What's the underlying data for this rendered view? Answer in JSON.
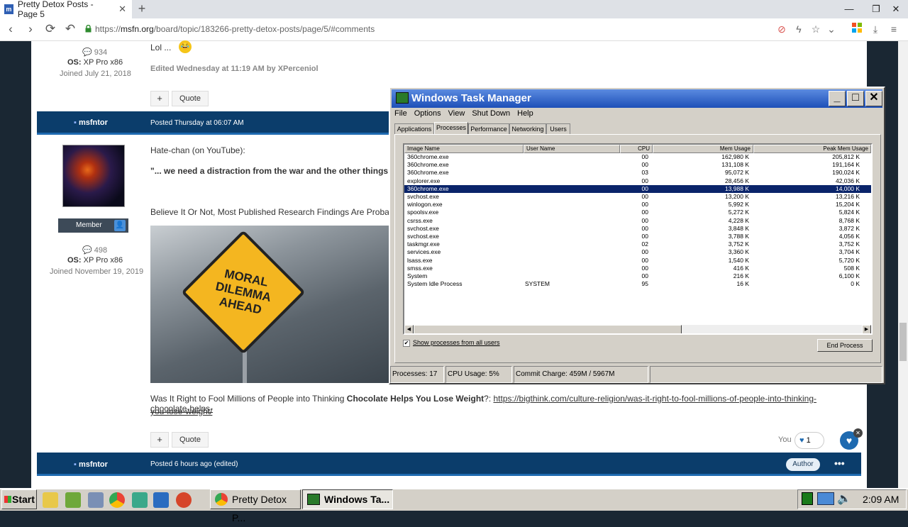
{
  "browser": {
    "tab_title": "Pretty Detox Posts - Page 5",
    "url_scheme": "https://",
    "url_domain": "msfn.org",
    "url_path": "/board/topic/183266-pretty-detox-posts/page/5/#comments"
  },
  "posts": [
    {
      "comments": "934",
      "os_label": "OS:",
      "os_value": "XP Pro x86",
      "joined": "Joined July 21, 2018",
      "body": "Lol ...",
      "edited": "Edited Wednesday at 11:19 AM by XPerceniol",
      "quote": "Quote"
    },
    {
      "author": "msfntor",
      "posted": "Posted Thursday at 06:07 AM",
      "rank": "Member",
      "comments": "498",
      "os_label": "OS:",
      "os_value": "XP Pro x86",
      "joined": "Joined November 19, 2019",
      "line1": "Hate-chan (on YouTube):",
      "line2": "\"... we need a distraction from the war and the other things",
      "line3": "Believe It Or Not, Most Published Research Findings Are Probably",
      "sign_l1": "MORAL",
      "sign_l2": "DILEMMA",
      "sign_l3": "AHEAD",
      "tail_pre": "Was It Right to Fool Millions of People into Thinking ",
      "tail_bold": "Chocolate Helps You Lose Weight",
      "tail_q": "?: ",
      "link1": "https://bigthink.com/culture-religion/was-it-right-to-fool-millions-of-people-into-thinking-chocolate-helps-",
      "link2": "you-lose-weight/",
      "quote": "Quote",
      "you": "You",
      "likes": "1"
    },
    {
      "author": "msfntor",
      "posted": "Posted 6 hours ago (edited)",
      "badge": "Author"
    }
  ],
  "taskmgr": {
    "title": "Windows Task Manager",
    "menu": [
      "File",
      "Options",
      "View",
      "Shut Down",
      "Help"
    ],
    "tabs": [
      "Applications",
      "Processes",
      "Performance",
      "Networking",
      "Users"
    ],
    "columns": [
      "Image Name",
      "User Name",
      "CPU",
      "Mem Usage",
      "Peak Mem Usage"
    ],
    "rows": [
      [
        "360chrome.exe",
        "",
        "00",
        "162,980 K",
        "205,812 K"
      ],
      [
        "360chrome.exe",
        "",
        "00",
        "131,108 K",
        "191,164 K"
      ],
      [
        "360chrome.exe",
        "",
        "03",
        "95,072 K",
        "190,024 K"
      ],
      [
        "explorer.exe",
        "",
        "00",
        "28,456 K",
        "42,036 K"
      ],
      [
        "360chrome.exe",
        "",
        "00",
        "13,988 K",
        "14,000 K"
      ],
      [
        "svchost.exe",
        "",
        "00",
        "13,200 K",
        "13,216 K"
      ],
      [
        "winlogon.exe",
        "",
        "00",
        "5,992 K",
        "15,204 K"
      ],
      [
        "spoolsv.exe",
        "",
        "00",
        "5,272 K",
        "5,824 K"
      ],
      [
        "csrss.exe",
        "",
        "00",
        "4,228 K",
        "8,768 K"
      ],
      [
        "svchost.exe",
        "",
        "00",
        "3,848 K",
        "3,872 K"
      ],
      [
        "svchost.exe",
        "",
        "00",
        "3,788 K",
        "4,056 K"
      ],
      [
        "taskmgr.exe",
        "",
        "02",
        "3,752 K",
        "3,752 K"
      ],
      [
        "services.exe",
        "",
        "00",
        "3,360 K",
        "3,704 K"
      ],
      [
        "lsass.exe",
        "",
        "00",
        "1,540 K",
        "5,720 K"
      ],
      [
        "smss.exe",
        "",
        "00",
        "416 K",
        "508 K"
      ],
      [
        "System",
        "",
        "00",
        "216 K",
        "6,100 K"
      ],
      [
        "System Idle Process",
        "SYSTEM",
        "95",
        "16 K",
        "0 K"
      ]
    ],
    "selected_row": 4,
    "show_all": "Show processes from all users",
    "end_process": "End Process",
    "status_processes": "Processes: 17",
    "status_cpu": "CPU Usage: 5%",
    "status_commit": "Commit Charge: 459M / 5967M"
  },
  "taskbar": {
    "start": "Start",
    "task1": "Pretty Detox P...",
    "task2": "Windows Ta...",
    "clock": "2:09 AM"
  }
}
